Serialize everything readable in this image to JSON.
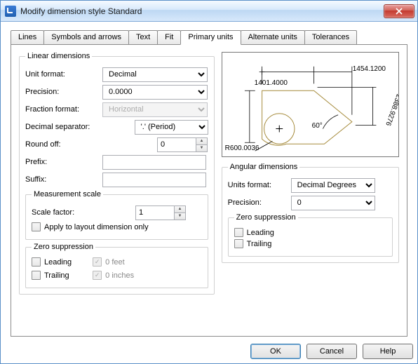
{
  "window": {
    "title": "Modify dimension style Standard"
  },
  "tabs": [
    "Lines",
    "Symbols and arrows",
    "Text",
    "Fit",
    "Primary units",
    "Alternate units",
    "Tolerances"
  ],
  "activeTab": "Primary units",
  "linear": {
    "legend": "Linear dimensions",
    "unit_format_label": "Unit format:",
    "unit_format": "Decimal",
    "precision_label": "Precision:",
    "precision": "0.0000",
    "fraction_format_label": "Fraction format:",
    "fraction_format": "Horizontal",
    "decimal_sep_label": "Decimal separator:",
    "decimal_sep": "'.' (Period)",
    "round_off_label": "Round off:",
    "round_off": "0",
    "prefix_label": "Prefix:",
    "prefix": "",
    "suffix_label": "Suffix:",
    "suffix": "",
    "measurement_legend": "Measurement scale",
    "scale_factor_label": "Scale factor:",
    "scale_factor": "1",
    "apply_layout": "Apply to layout dimension only",
    "zero_legend": "Zero suppression",
    "leading": "Leading",
    "trailing": "Trailing",
    "zero_feet": "0 feet",
    "zero_inches": "0 inches"
  },
  "angular": {
    "legend": "Angular dimensions",
    "units_format_label": "Units format:",
    "units_format": "Decimal Degrees",
    "precision_label": "Precision:",
    "precision": "0",
    "zero_legend": "Zero suppression",
    "leading": "Leading",
    "trailing": "Trailing"
  },
  "preview": {
    "dim1": "1454.1200",
    "dim2": "1401.4000",
    "dim3": "2388.9276",
    "rad": "R600.0036",
    "ang": "60°"
  },
  "buttons": {
    "ok": "OK",
    "cancel": "Cancel",
    "help": "Help"
  }
}
